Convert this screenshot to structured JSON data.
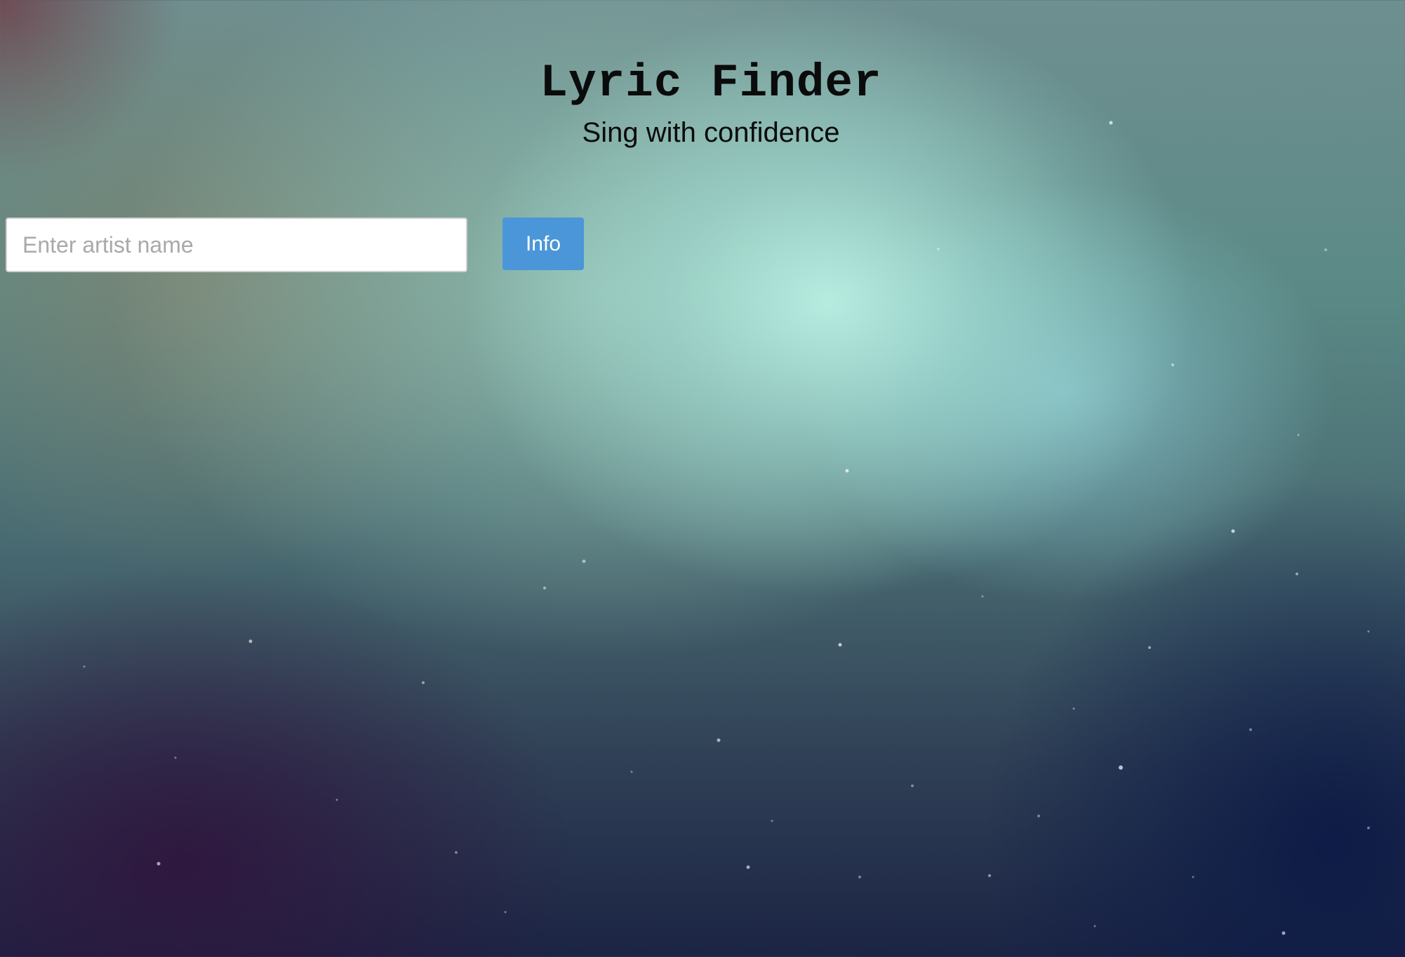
{
  "header": {
    "title": "Lyric Finder",
    "subtitle": "Sing with confidence"
  },
  "search": {
    "placeholder": "Enter artist name",
    "value": ""
  },
  "actions": {
    "info_label": "Info",
    "info_color": "#4a96d8"
  },
  "theme": {
    "background": "starry-aurora-gradient",
    "text_color": "#0b0b0b"
  }
}
